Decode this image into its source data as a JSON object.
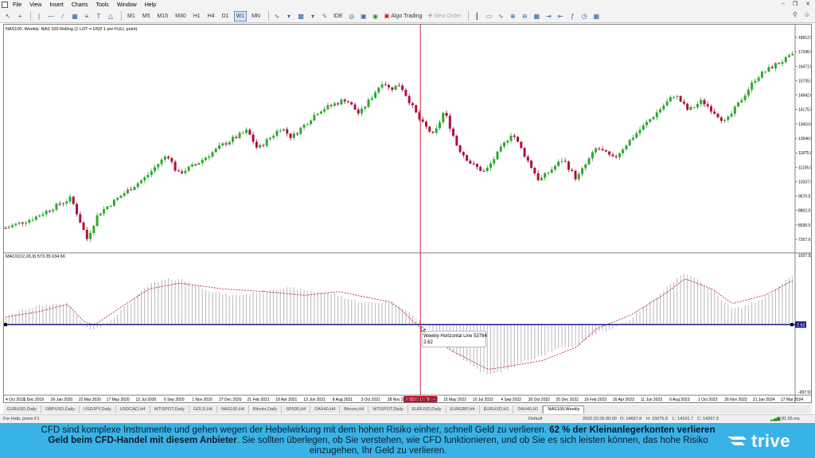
{
  "menu": [
    "File",
    "View",
    "Insert",
    "Charts",
    "Tools",
    "Window",
    "Help"
  ],
  "toolbar": {
    "timeframes": [
      "M1",
      "M5",
      "M15",
      "M30",
      "H1",
      "H4",
      "D1",
      "W1",
      "MN"
    ],
    "active_timeframe": "W1",
    "ide_label": "IDE",
    "algo_label": "Algo Trading",
    "new_order_label": "New Order"
  },
  "chart": {
    "header": "NAS100, Weekly:  NAS 100 Rolling (1 LOT = USD 1 per FULL point)",
    "macd_label": "MACD(12,26,9) 573.35 634.66",
    "price_labels": [
      "18912.5",
      "17245.5",
      "16471.0",
      "15705.5",
      "14942.0",
      "14175.5",
      "13410.0",
      "12640.5",
      "11875.0",
      "11105.0",
      "10337.5",
      "9570.5",
      "8802.0",
      "8035.0",
      "7267.6"
    ],
    "macd_top_label": "1027.92",
    "macd_bottom_label": "-997.53",
    "hline_value": "2.62",
    "tooltip_title": "Weekly Horizontal Line 53784",
    "tooltip_value": "2.62",
    "crosshair_date": "2022.02.06 00:00",
    "date_labels": [
      "4 Oct 2019",
      "1 Dec 2019",
      "26 Jan 2020",
      "22 Mar 2020",
      "17 May 2020",
      "12 Jul 2020",
      "6 Sep 2020",
      "1 Nov 2020",
      "27 Dec 2020",
      "21 Feb 2021",
      "18 Apr 2021",
      "13 Jun 2021",
      "8 Aug 2021",
      "3 Oct 2021",
      "28 Nov 2021",
      "20 Mar 2022",
      "15 May 2022",
      "10 Jul 2022",
      "4 Sep 2022",
      "30 Oct 2022",
      "25 Dec 2022",
      "19 Feb 2023",
      "16 Apr 2023",
      "11 Jun 2023",
      "6 Aug 2023",
      "1 Oct 2023",
      "26 Nov 2023",
      "21 Jan 2024",
      "17 Mar 2024"
    ]
  },
  "tabs": [
    "EURUSD,Daily",
    "GBPUSD,Daily",
    "USDJPY,Daily",
    "USDCAD,H4",
    "WTISPOT,Daily",
    "GOLD,H4",
    "NAS100,H4",
    "Bitcoin,Daily",
    "SP500,H4",
    "DAX40,H4",
    "Bitcoin,H4",
    "WTISPOT,Daily",
    "EURUSD,Daily",
    "EURGBP,H4",
    "EURUSD,H1",
    "DAX40,H1",
    "NAS100,Weekly"
  ],
  "active_tab": "NAS100,Weekly",
  "status": {
    "help": "For Help, press F1",
    "profile": "Default",
    "time": "2022.02.06 00:00",
    "open": "O: 14697.8",
    "high": "H: 15075.8",
    "low": "L: 14191.7",
    "close": "C: 14267.9",
    "traffic": "81.65 ms"
  },
  "disclaimer": {
    "part1": "CFD sind komplexe Instrumente und gehen wegen der Hebelwirkung mit dem hohen Risiko einher, schnell Geld zu verlieren. ",
    "bold": "62 % der Kleinanlegerkonten verlieren Geld beim CFD-Handel mit diesem Anbieter",
    "part2": ". Sie sollten überlegen, ob Sie verstehen, wie CFD funktionieren, und ob Sie es sich leisten können, das hohe Risiko einzugehen, Ihr Geld zu verlieren."
  },
  "brand": "trive",
  "colors": {
    "bull": "#2fa82f",
    "bear": "#b0103a",
    "crosshair": "#c8102e",
    "hline": "#1a1a8c",
    "macd_signal": "#b0103a",
    "banner": "#39b2e6"
  },
  "chart_data": {
    "type": "candlestick",
    "timeframe": "Weekly",
    "anchors": [
      [
        "2019-10-04",
        7850
      ],
      [
        "2019-12-01",
        8450
      ],
      [
        "2020-02-16",
        9650
      ],
      [
        "2020-03-20",
        7200
      ],
      [
        "2020-04-12",
        8700
      ],
      [
        "2020-06-07",
        10000
      ],
      [
        "2020-07-19",
        10900
      ],
      [
        "2020-09-02",
        12300
      ],
      [
        "2020-09-23",
        11100
      ],
      [
        "2020-11-01",
        11700
      ],
      [
        "2020-12-27",
        12900
      ],
      [
        "2021-02-14",
        13700
      ],
      [
        "2021-03-07",
        12600
      ],
      [
        "2021-04-25",
        13900
      ],
      [
        "2021-05-16",
        13300
      ],
      [
        "2021-07-11",
        14900
      ],
      [
        "2021-09-05",
        15600
      ],
      [
        "2021-10-03",
        14700
      ],
      [
        "2021-11-21",
        16700
      ],
      [
        "2021-12-05",
        16200
      ],
      [
        "2021-12-26",
        16500
      ],
      [
        "2022-02-06",
        14270
      ],
      [
        "2022-03-06",
        13400
      ],
      [
        "2022-03-27",
        14900
      ],
      [
        "2022-04-24",
        12700
      ],
      [
        "2022-05-22",
        11700
      ],
      [
        "2022-06-19",
        11200
      ],
      [
        "2022-08-14",
        13600
      ],
      [
        "2022-10-09",
        10700
      ],
      [
        "2022-11-27",
        12000
      ],
      [
        "2022-12-25",
        10800
      ],
      [
        "2023-02-05",
        12700
      ],
      [
        "2023-03-12",
        12000
      ],
      [
        "2023-04-16",
        13200
      ],
      [
        "2023-07-16",
        15900
      ],
      [
        "2023-08-13",
        14900
      ],
      [
        "2023-09-10",
        15500
      ],
      [
        "2023-10-29",
        14200
      ],
      [
        "2023-12-31",
        16900
      ],
      [
        "2024-02-04",
        17600
      ],
      [
        "2024-03-17",
        18250
      ]
    ],
    "price_axis": {
      "min": 7267.6,
      "max": 18912.5
    },
    "hline_price": 2.62,
    "macd": {
      "params": [
        12,
        26,
        9
      ],
      "main": 573.35,
      "signal": 634.66,
      "range": [
        -997.53,
        1027.92
      ],
      "signal_anchors": [
        [
          "2019-10-04",
          120
        ],
        [
          "2019-12-15",
          210
        ],
        [
          "2020-02-09",
          320
        ],
        [
          "2020-03-15",
          40
        ],
        [
          "2020-04-05",
          0
        ],
        [
          "2020-06-07",
          320
        ],
        [
          "2020-07-26",
          560
        ],
        [
          "2020-09-27",
          650
        ],
        [
          "2020-12-27",
          560
        ],
        [
          "2021-03-21",
          520
        ],
        [
          "2021-06-13",
          460
        ],
        [
          "2021-08-22",
          520
        ],
        [
          "2021-10-17",
          430
        ],
        [
          "2021-12-05",
          360
        ],
        [
          "2021-12-26",
          250
        ],
        [
          "2022-02-06",
          -50
        ],
        [
          "2022-04-10",
          -400
        ],
        [
          "2022-06-26",
          -700
        ],
        [
          "2022-08-07",
          -650
        ],
        [
          "2022-10-16",
          -560
        ],
        [
          "2022-12-25",
          -350
        ],
        [
          "2023-02-05",
          -60
        ],
        [
          "2023-04-16",
          150
        ],
        [
          "2023-06-25",
          480
        ],
        [
          "2023-08-06",
          720
        ],
        [
          "2023-10-01",
          560
        ],
        [
          "2023-11-12",
          330
        ],
        [
          "2024-01-21",
          470
        ],
        [
          "2024-03-17",
          700
        ]
      ]
    }
  }
}
